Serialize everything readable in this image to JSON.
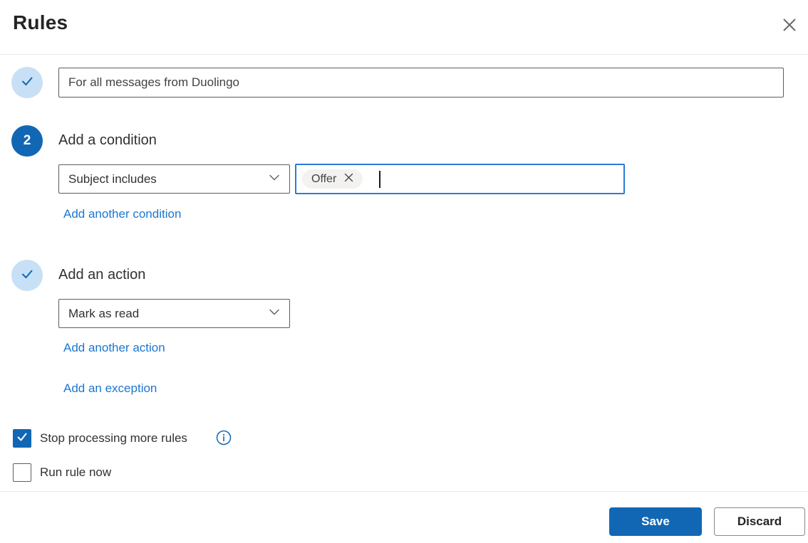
{
  "dialog": {
    "title": "Rules"
  },
  "colors": {
    "accent_blue": "#1267b4",
    "link_blue": "#1b76d1",
    "chip_input_border": "#2b7cd3",
    "light_circle_blue": "#c7e0f6",
    "chip_background": "#f3f2f1",
    "input_border": "#605e5c",
    "divider": "#ebebeb",
    "text_dark": "#323130"
  },
  "step1": {
    "status": "completed",
    "rule_name_value": "For all messages from Duolingo"
  },
  "step2": {
    "badge_number": "2",
    "heading": "Add a condition",
    "condition_dropdown": {
      "selected_value": "Subject includes"
    },
    "condition_value_input": {
      "chips": [
        {
          "label": "Offer"
        }
      ]
    },
    "add_condition_link": "Add another condition"
  },
  "step3": {
    "status": "completed",
    "heading": "Add an action",
    "action_dropdown": {
      "selected_value": "Mark as read"
    },
    "add_action_link": "Add another action",
    "add_exception_link": "Add an exception"
  },
  "options": {
    "stop_processing": {
      "label": "Stop processing more rules",
      "checked": true
    },
    "run_rule_now": {
      "label": "Run rule now",
      "checked": false
    }
  },
  "footer": {
    "save_label": "Save",
    "discard_label": "Discard"
  }
}
